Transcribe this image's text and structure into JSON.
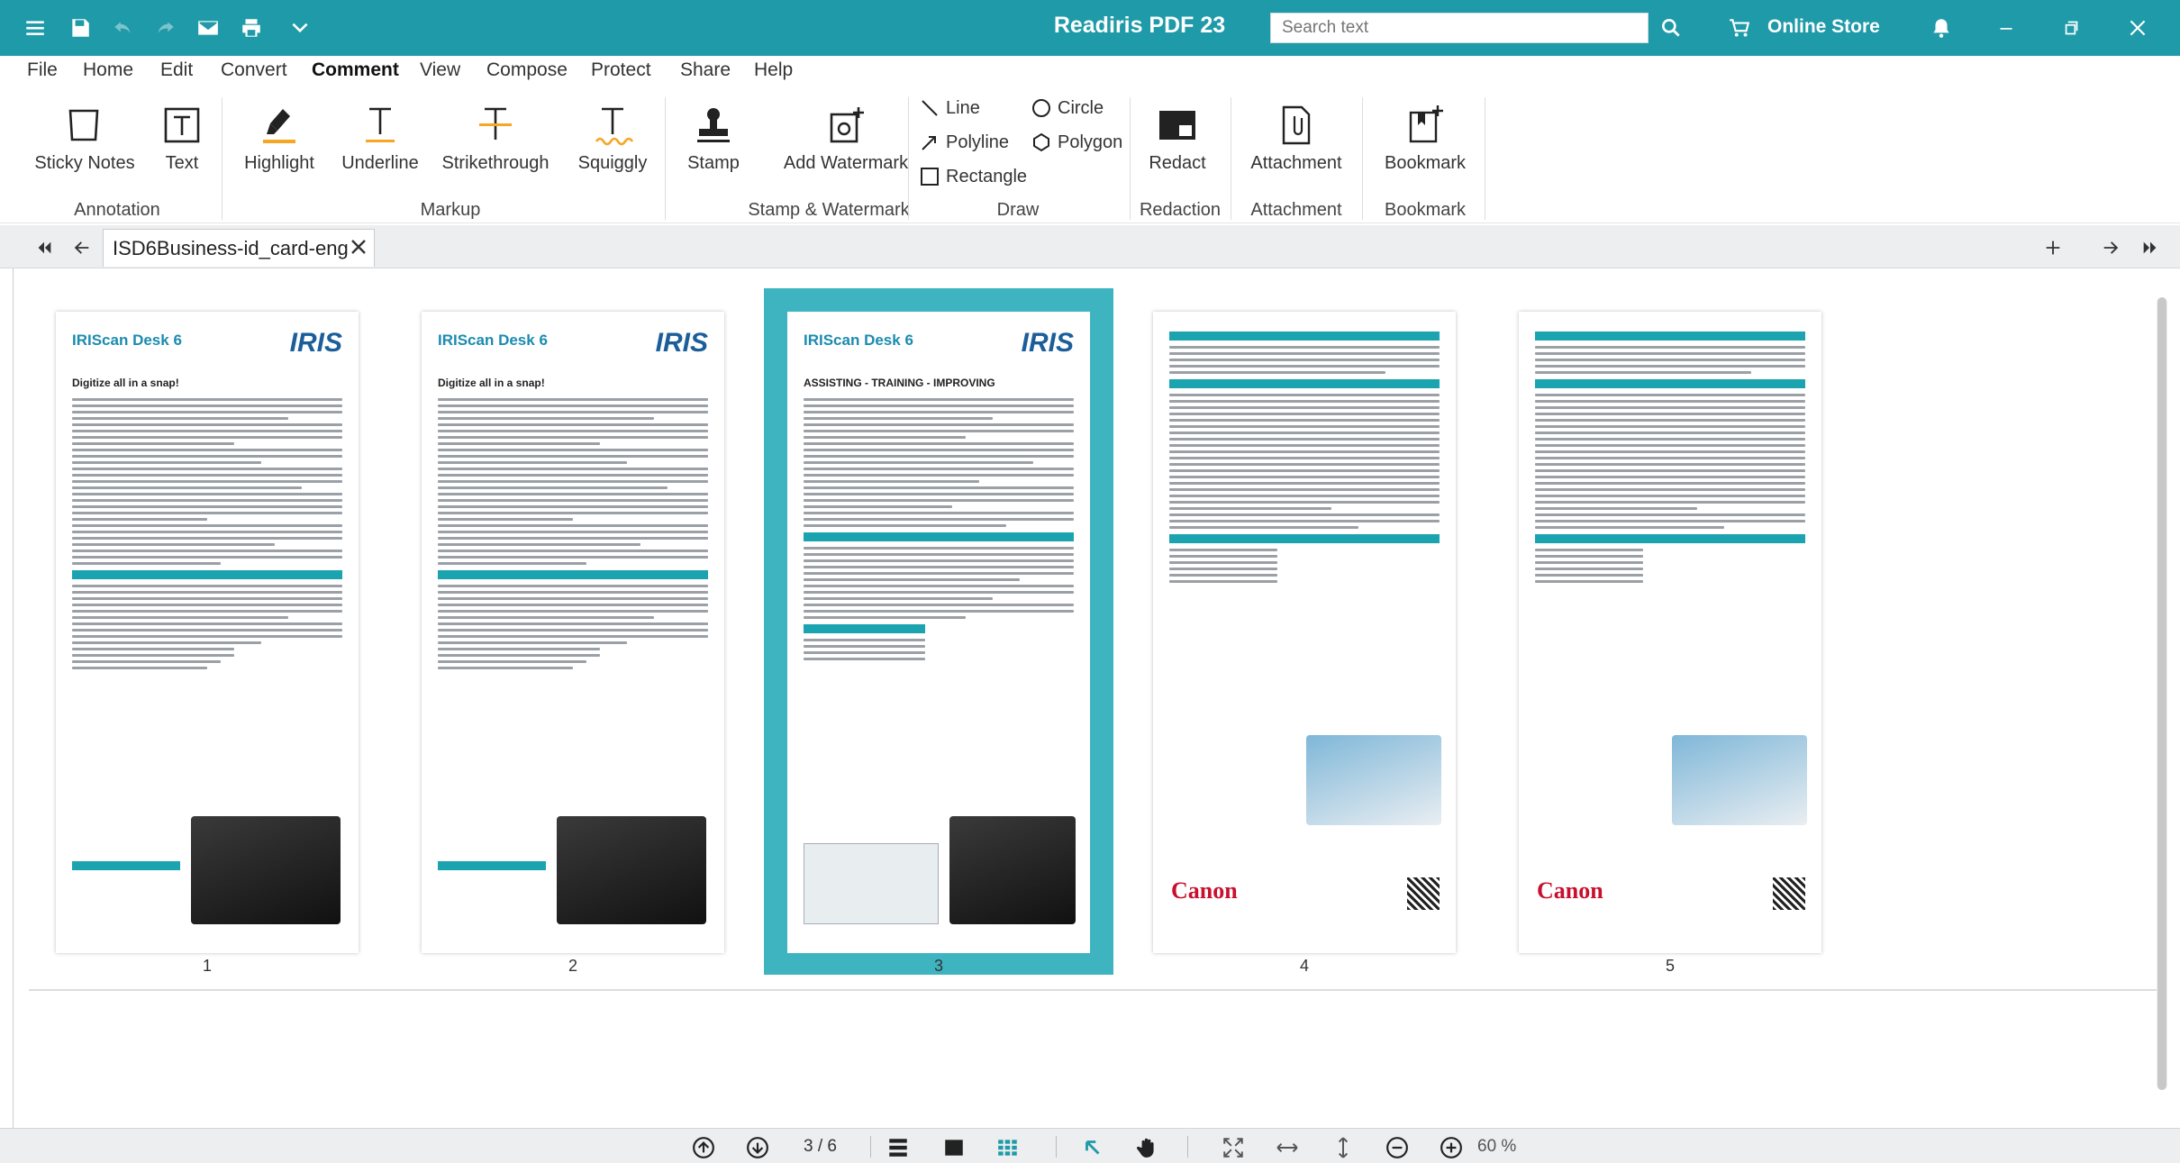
{
  "window": {
    "title": "Readiris PDF 23",
    "store_label": "Online Store"
  },
  "search": {
    "placeholder": "Search text"
  },
  "menu": [
    "File",
    "Home",
    "Edit",
    "Convert",
    "Comment",
    "View",
    "Compose",
    "Protect",
    "Share",
    "Help"
  ],
  "menu_active": "Comment",
  "ribbon": {
    "annotation": {
      "group": "Annotation",
      "sticky_notes": "Sticky Notes",
      "text": "Text"
    },
    "markup": {
      "group": "Markup",
      "highlight": "Highlight",
      "underline": "Underline",
      "strikethrough": "Strikethrough",
      "squiggly": "Squiggly"
    },
    "stamp": {
      "group": "Stamp & Watermark",
      "stamp": "Stamp",
      "add_watermark": "Add Watermark"
    },
    "draw": {
      "group": "Draw",
      "line": "Line",
      "circle": "Circle",
      "polyline": "Polyline",
      "polygon": "Polygon",
      "rectangle": "Rectangle"
    },
    "redaction": {
      "group": "Redaction",
      "redact": "Redact"
    },
    "attachment": {
      "group": "Attachment",
      "attachment": "Attachment"
    },
    "bookmark": {
      "group": "Bookmark",
      "bookmark": "Bookmark"
    }
  },
  "tab": {
    "label": "ISD6Business-id_card-eng"
  },
  "pages": [
    {
      "num": "1",
      "logo": "IRIScan Desk 6",
      "brand": "IRIS",
      "title": "Digitize all in a snap!"
    },
    {
      "num": "2",
      "logo": "IRIScan Desk 6",
      "brand": "IRIS",
      "title": "Digitize all in a snap!"
    },
    {
      "num": "3",
      "logo": "IRIScan Desk 6",
      "brand": "IRIS",
      "title": "ASSISTING - TRAINING - IMPROVING"
    },
    {
      "num": "4",
      "canon": "Canon"
    },
    {
      "num": "5",
      "canon": "Canon"
    }
  ],
  "status": {
    "page_count": "3 / 6",
    "zoom": "60 %"
  },
  "colors": {
    "accent": "#1e9aa8",
    "selection": "#3eb4c1",
    "highlight": "#f5a623"
  }
}
